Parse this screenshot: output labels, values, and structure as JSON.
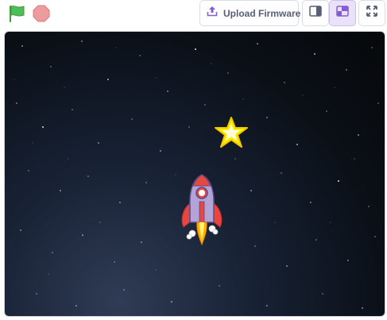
{
  "toolbar": {
    "green_flag_icon": "green-flag-icon",
    "stop_icon": "stop-sign-icon",
    "upload_button_label": "Upload Firmware",
    "upload_icon": "upload-icon",
    "small_stage_icon": "small-stage-icon",
    "large_stage_icon": "large-stage-icon",
    "fullscreen_icon": "fullscreen-icon"
  },
  "stage": {
    "backdrop": "starfield-night-sky",
    "sprites": [
      "star",
      "rocketship"
    ]
  },
  "colors": {
    "accent": "#855cd6",
    "text": "#575e75",
    "flag_green": "#4cbf56",
    "stop_red": "#ec9c9c",
    "star_yellow": "#fff200",
    "rocket_purple": "#b2a4d6",
    "rocket_red": "#e8463f"
  }
}
